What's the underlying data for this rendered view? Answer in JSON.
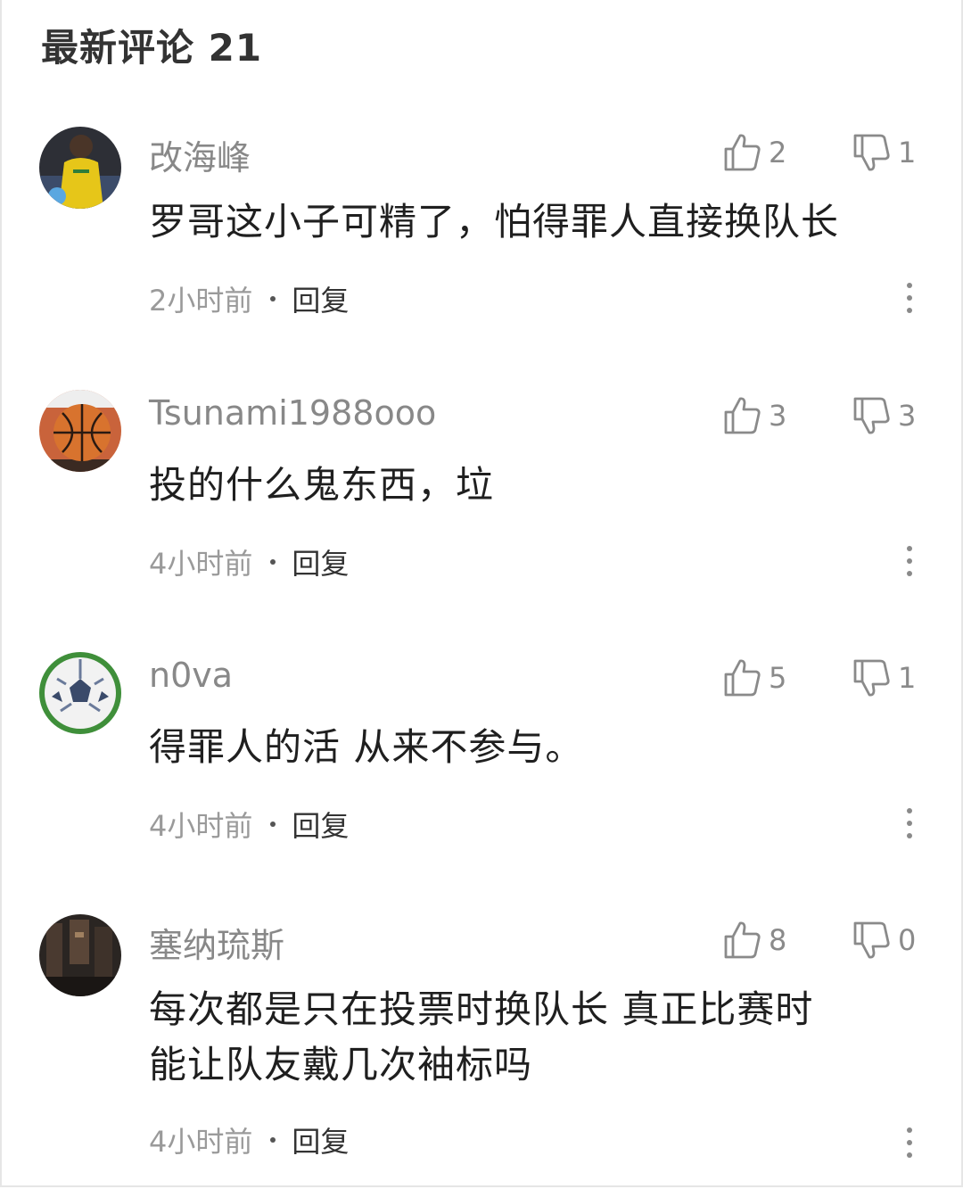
{
  "section": {
    "title": "最新评论 21"
  },
  "comments": [
    {
      "username": "改海峰",
      "avatar_icon": "kid-yellow-jersey-avatar",
      "likes": "2",
      "dislikes": "1",
      "text_lines": [
        "罗哥这小子可精了，怕得罪人直接换队长"
      ],
      "time": "2小时前",
      "reply_label": "回复"
    },
    {
      "username": "Tsunami1988ooo",
      "avatar_icon": "basketball-avatar",
      "likes": "3",
      "dislikes": "3",
      "text_lines": [
        "投的什么鬼东西，垃"
      ],
      "time": "4小时前",
      "reply_label": "回复"
    },
    {
      "username": "n0va",
      "avatar_icon": "soccer-ball-avatar",
      "likes": "5",
      "dislikes": "1",
      "text_lines": [
        "得罪人的活 从来不参与。"
      ],
      "time": "4小时前",
      "reply_label": "回复"
    },
    {
      "username": "塞纳琉斯",
      "avatar_icon": "dark-room-avatar",
      "likes": "8",
      "dislikes": "0",
      "text_lines": [
        "每次都是只在投票时换队长 真正比赛时",
        "能让队友戴几次袖标吗"
      ],
      "time": "4小时前",
      "reply_label": "回复"
    }
  ],
  "colors": {
    "username": "#888888",
    "body_text": "#1f1f1f",
    "meta": "#9a9a9a",
    "icon": "#8a8a8a"
  }
}
